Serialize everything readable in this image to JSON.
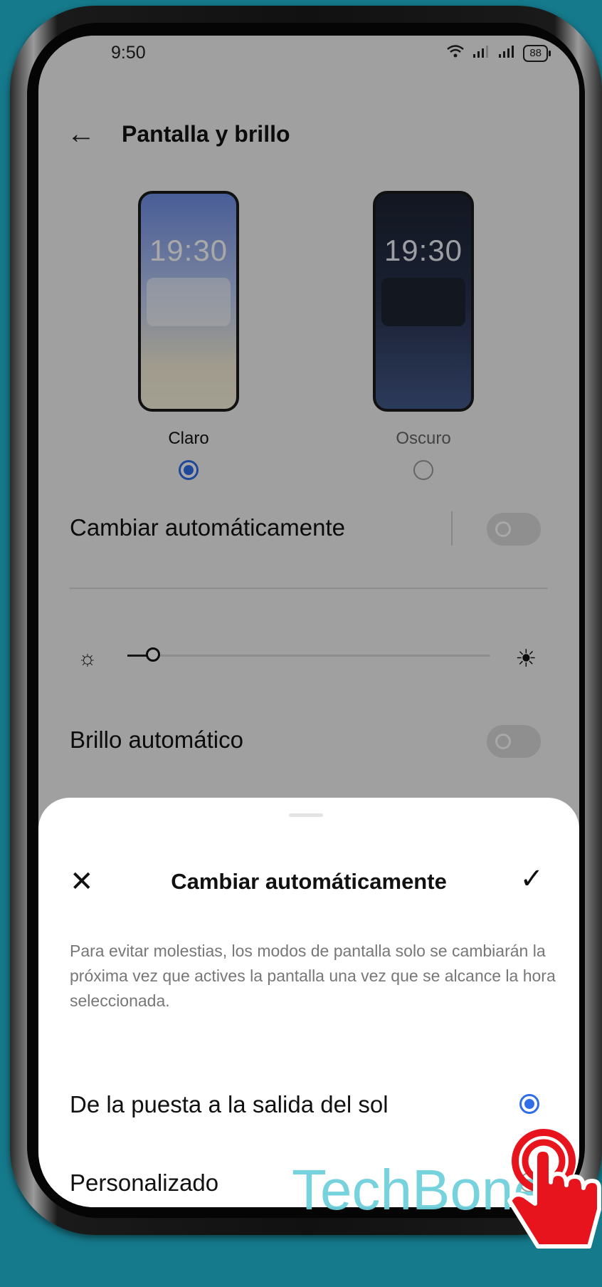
{
  "status_bar": {
    "time": "9:50",
    "battery": "88",
    "wifi_icon": "wifi-icon",
    "signal_icon": "signal-icon"
  },
  "header": {
    "back_icon": "back-arrow-icon",
    "title": "Pantalla y brillo"
  },
  "theme_modes": {
    "light": {
      "label": "Claro",
      "preview_time": "19:30",
      "selected": true
    },
    "dark": {
      "label": "Oscuro",
      "preview_time": "19:30",
      "selected": false
    }
  },
  "auto_switch": {
    "label": "Cambiar automáticamente",
    "enabled": false
  },
  "brightness": {
    "level": 0.07,
    "low_icon": "sun-small-icon",
    "high_icon": "sun-large-icon"
  },
  "auto_brightness": {
    "label": "Brillo automático",
    "enabled": false
  },
  "sheet": {
    "title": "Cambiar automáticamente",
    "close_icon": "close-icon",
    "confirm_icon": "check-icon",
    "description": "Para evitar molestias, los modos de pantalla solo se cambiarán la próxima vez que actives la pantalla una vez que se alcance la hora seleccionada.",
    "options": [
      {
        "label": "De la puesta a la salida del sol",
        "selected": true
      },
      {
        "label": "Personalizado",
        "selected": false
      }
    ]
  },
  "watermark": "TechBone",
  "colors": {
    "accent": "#2f6ee8",
    "background": "#157a8c",
    "pointer": "#e8141d"
  }
}
